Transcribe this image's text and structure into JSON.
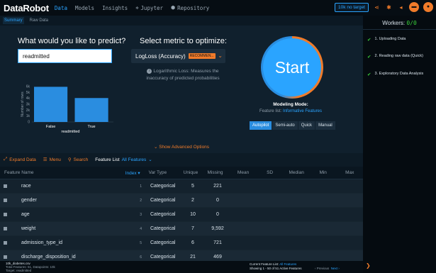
{
  "app": {
    "logo": "DataRobot",
    "nav": [
      {
        "label": "Data",
        "active": true,
        "icon": ""
      },
      {
        "label": "Models",
        "active": false,
        "icon": ""
      },
      {
        "label": "Insights",
        "active": false,
        "icon": ""
      },
      {
        "label": "Jupyter",
        "active": false,
        "icon": "jupyter-icon"
      },
      {
        "label": "Repository",
        "active": false,
        "icon": "repository-icon"
      }
    ],
    "project_name": "10k no target"
  },
  "subtabs": [
    "Summary",
    "Raw Data"
  ],
  "predict": {
    "question": "What would you like to predict?",
    "target_value": "readmitted"
  },
  "metric": {
    "title": "Select metric to optimize:",
    "selected": "LogLoss (Accuracy)",
    "badge": "RECOMMEN...",
    "description": "Logarithmic Loss: Measures the inaccuracy of predicted probabilities"
  },
  "start": {
    "label": "Start",
    "mode_title": "Modeling Mode:",
    "feature_list_label": "Feature list:",
    "feature_list_value": "Informative Features",
    "modes": [
      {
        "label": "Autopilot",
        "active": true
      },
      {
        "label": "Semi-auto",
        "active": false
      },
      {
        "label": "Quick",
        "active": false
      },
      {
        "label": "Manual",
        "active": false
      }
    ],
    "advanced": "Show Advanced Options"
  },
  "chart_data": {
    "type": "bar",
    "categories": [
      "False",
      "True"
    ],
    "values": [
      5950,
      4050
    ],
    "xlabel": "readmitted",
    "ylabel": "Number of rows",
    "yticks": [
      "0",
      "1k",
      "2k",
      "3k",
      "4k",
      "5k",
      "6k"
    ],
    "ylim": [
      0,
      6000
    ],
    "color": "#2a8de0"
  },
  "feature_toolbar": {
    "expand": "Expand Data",
    "menu": "Menu",
    "search": "Search",
    "feature_list_label": "Feature List",
    "feature_list_value": "All Features"
  },
  "table": {
    "columns": [
      "Feature Name",
      "Index",
      "Var Type",
      "Unique",
      "Missing",
      "Mean",
      "SD",
      "Median",
      "Min",
      "Max"
    ],
    "rows": [
      {
        "name": "race",
        "index": "1",
        "type": "Categorical",
        "unique": "5",
        "missing": "221"
      },
      {
        "name": "gender",
        "index": "2",
        "type": "Categorical",
        "unique": "2",
        "missing": "0"
      },
      {
        "name": "age",
        "index": "3",
        "type": "Categorical",
        "unique": "10",
        "missing": "0"
      },
      {
        "name": "weight",
        "index": "4",
        "type": "Categorical",
        "unique": "7",
        "missing": "9,592"
      },
      {
        "name": "admission_type_id",
        "index": "5",
        "type": "Categorical",
        "unique": "6",
        "missing": "721"
      },
      {
        "name": "discharge_disposition_id",
        "index": "6",
        "type": "Categorical",
        "unique": "21",
        "missing": "469"
      }
    ]
  },
  "footer": {
    "filename": "10k_diabetes.csv",
    "summary": "Total Features: 51, Datapoints: 10k",
    "target": "Target: readmitted",
    "current_list_label": "Current Feature List:",
    "current_list_value": "All Features",
    "showing": "Showing 1 - 50 of 51 Active Features",
    "prev": "Previous",
    "next": "Next"
  },
  "workers": {
    "label": "Workers:",
    "count": "0/0",
    "steps": [
      "1. Uploading Data",
      "2. Reading raw data (Quick)",
      "3. Exploratory Data Analysis"
    ]
  }
}
